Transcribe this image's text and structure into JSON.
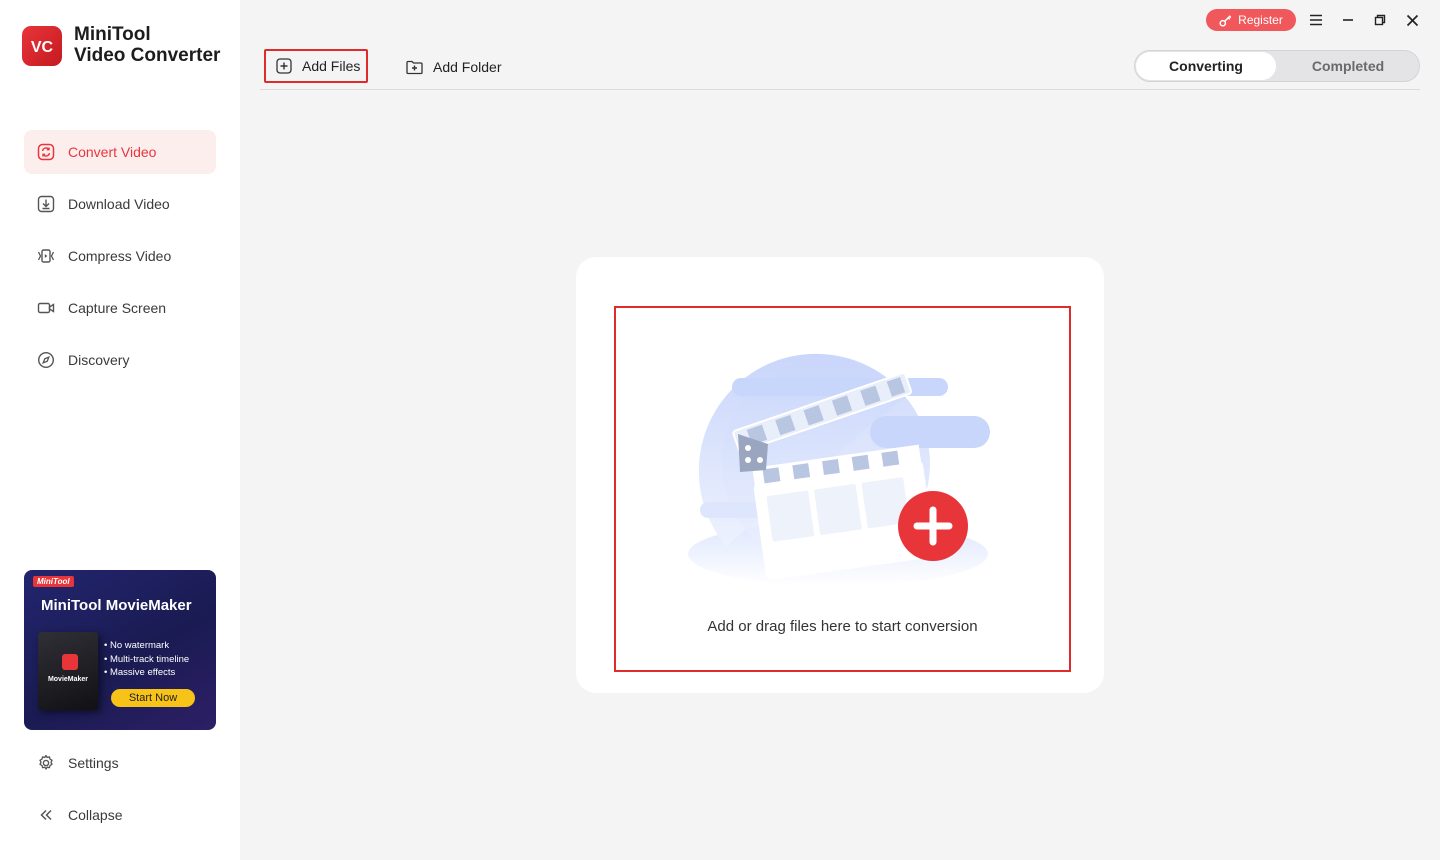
{
  "app": {
    "logo_text": "VC",
    "name_line1": "MiniTool",
    "name_line2": "Video Converter"
  },
  "sidebar": {
    "items": [
      {
        "label": "Convert Video",
        "icon": "convert-icon",
        "active": true
      },
      {
        "label": "Download Video",
        "icon": "download-icon",
        "active": false
      },
      {
        "label": "Compress Video",
        "icon": "compress-icon",
        "active": false
      },
      {
        "label": "Capture Screen",
        "icon": "camera-icon",
        "active": false
      },
      {
        "label": "Discovery",
        "icon": "compass-icon",
        "active": false
      }
    ],
    "promo": {
      "tag": "MiniTool",
      "title": "MiniTool MovieMaker",
      "box_label": "MovieMaker",
      "features": [
        "No watermark",
        "Multi-track timeline",
        "Massive effects"
      ],
      "cta": "Start Now"
    },
    "settings_label": "Settings",
    "collapse_label": "Collapse"
  },
  "titlebar": {
    "register_label": "Register"
  },
  "toolbar": {
    "add_files_label": "Add Files",
    "add_folder_label": "Add Folder"
  },
  "tabs": {
    "converting": "Converting",
    "completed": "Completed"
  },
  "dropzone": {
    "text": "Add or drag files here to start conversion"
  },
  "colors": {
    "accent": "#e8353a",
    "highlight_border": "#e02b2b",
    "register_bg": "#f0585c",
    "promo_cta": "#f7c318"
  }
}
